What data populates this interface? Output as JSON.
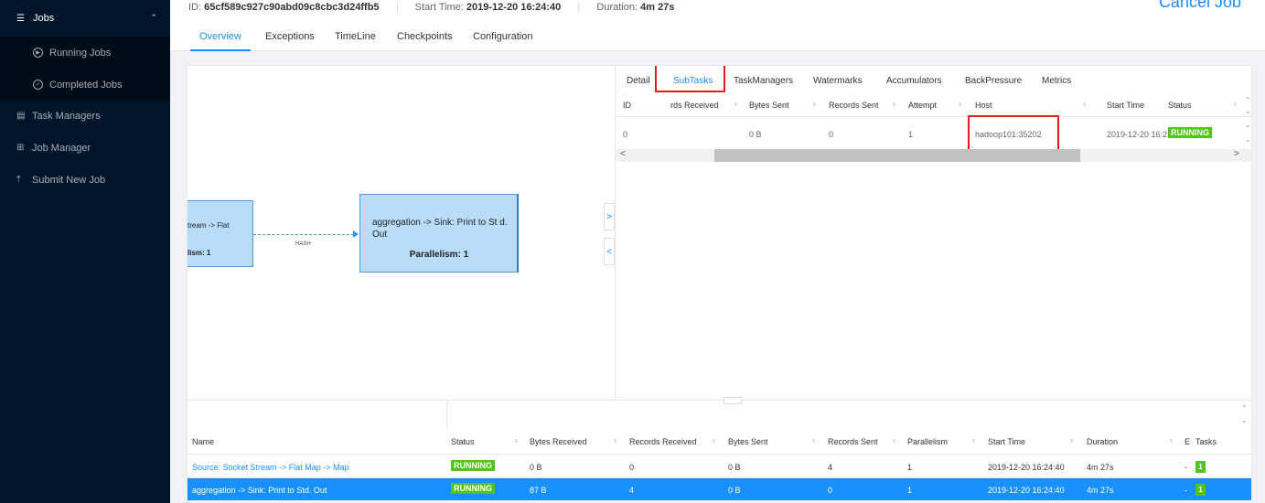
{
  "sidebar": {
    "jobs": "Jobs",
    "running_jobs": "Running Jobs",
    "completed_jobs": "Completed Jobs",
    "task_managers": "Task Managers",
    "job_manager": "Job Manager",
    "submit_new_job": "Submit New Job"
  },
  "header": {
    "id_label": "ID:",
    "id_value": "65cf589c927c90abd09c8cbc3d24ffb5",
    "start_label": "Start Time:",
    "start_value": "2019-12-20 16:24:40",
    "duration_label": "Duration:",
    "duration_value": "4m 27s",
    "cancel": "Cancel Job",
    "tabs": [
      "Overview",
      "Exceptions",
      "TimeLine",
      "Checkpoints",
      "Configuration"
    ]
  },
  "graph": {
    "node1_title": "tream -> Flat",
    "node1_parallelism": "lism: 1",
    "edge_label": "HASH",
    "node2_title": "aggregation -> Sink: Print to St d. Out",
    "node2_parallelism": "Parallelism: 1"
  },
  "subtasks": {
    "tabs": [
      "Detail",
      "SubTasks",
      "TaskManagers",
      "Watermarks",
      "Accumulators",
      "BackPressure",
      "Metrics"
    ],
    "columns": [
      "ID",
      "rds Received",
      "Bytes Sent",
      "Records Sent",
      "Attempt",
      "Host",
      "Start Time",
      "Status"
    ],
    "row": {
      "id": "0",
      "bytes_sent": "0 B",
      "records_sent": "0",
      "attempt": "1",
      "host": "hadoop101:35202",
      "start_time": "2019-12-20 16:2",
      "status": "RUNNING"
    }
  },
  "vertices": {
    "columns": [
      "Name",
      "Status",
      "Bytes Received",
      "Records Received",
      "Bytes Sent",
      "Records Sent",
      "Parallelism",
      "Start Time",
      "Duration",
      "E",
      "Tasks"
    ],
    "rows": [
      {
        "name": "Source: Socket Stream -> Flat Map -> Map",
        "status": "RUNNING",
        "bytes_received": "0 B",
        "records_received": "0",
        "bytes_sent": "0 B",
        "records_sent": "4",
        "parallelism": "1",
        "start_time": "2019-12-20 16:24:40",
        "duration": "4m 27s",
        "end": "-",
        "tasks": "1"
      },
      {
        "name": "aggregation -> Sink: Print to Std. Out",
        "status": "RUNNING",
        "bytes_received": "87 B",
        "records_received": "4",
        "bytes_sent": "0 B",
        "records_sent": "0",
        "parallelism": "1",
        "start_time": "2019-12-20 16:24:40",
        "duration": "4m 27s",
        "end": "-",
        "tasks": "1"
      }
    ]
  },
  "colors": {
    "accent": "#1890ff",
    "sidebar": "#001529",
    "running": "#52c41a",
    "highlight": "#e02020"
  }
}
